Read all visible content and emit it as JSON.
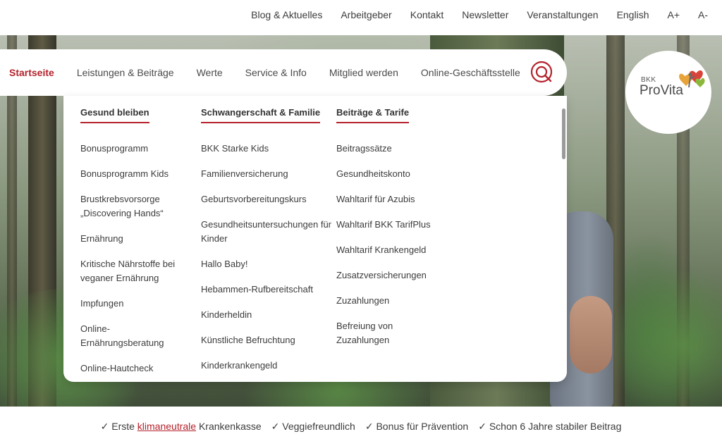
{
  "topbar": {
    "links": [
      "Blog & Aktuelles",
      "Arbeitgeber",
      "Kontakt",
      "Newsletter",
      "Veranstaltungen",
      "English",
      "A+",
      "A-"
    ]
  },
  "nav": {
    "items": [
      "Startseite",
      "Leistungen & Beiträge",
      "Werte",
      "Service & Info",
      "Mitglied werden",
      "Online-Geschäftsstelle"
    ],
    "active": "Startseite"
  },
  "logo": {
    "bkk": "BKK",
    "name": "ProVita"
  },
  "dropdown": {
    "columns": [
      {
        "title": "Gesund bleiben",
        "items": [
          "Bonusprogramm",
          "Bonusprogramm Kids",
          "Brustkrebsvorsorge „Discovering Hands“",
          "Ernährung",
          "Kritische Nährstoffe bei veganer Ernährung",
          "Impfungen",
          "Online-Ernährungsberatung",
          "Online-Hautcheck"
        ]
      },
      {
        "title": "Schwangerschaft & Familie",
        "items": [
          "BKK Starke Kids",
          "Familienversicherung",
          "Geburtsvorbereitungskurs",
          "Gesundheitsuntersuchungen für Kinder",
          "Hallo Baby!",
          "Hebammen-Rufbereitschaft",
          "Kinderheldin",
          "Künstliche Befruchtung",
          "Kinderkrankengeld"
        ]
      },
      {
        "title": "Beiträge & Tarife",
        "items": [
          "Beitragssätze",
          "Gesundheitskonto",
          "Wahltarif für Azubis",
          "Wahltarif BKK TarifPlus",
          "Wahltarif Krankengeld",
          "Zusatzversicherungen",
          "Zuzahlungen",
          "Befreiung von Zuzahlungen"
        ]
      }
    ]
  },
  "footer": {
    "item1_prefix": "✓ Erste ",
    "item1_link": "klimaneutrale",
    "item1_suffix": " Krankenkasse",
    "item2": "✓ Veggiefreundlich",
    "item3": "✓ Bonus für Prävention",
    "item4": "✓ Schon 6 Jahre stabiler Beitrag"
  },
  "colors": {
    "accent": "#b4222c"
  }
}
